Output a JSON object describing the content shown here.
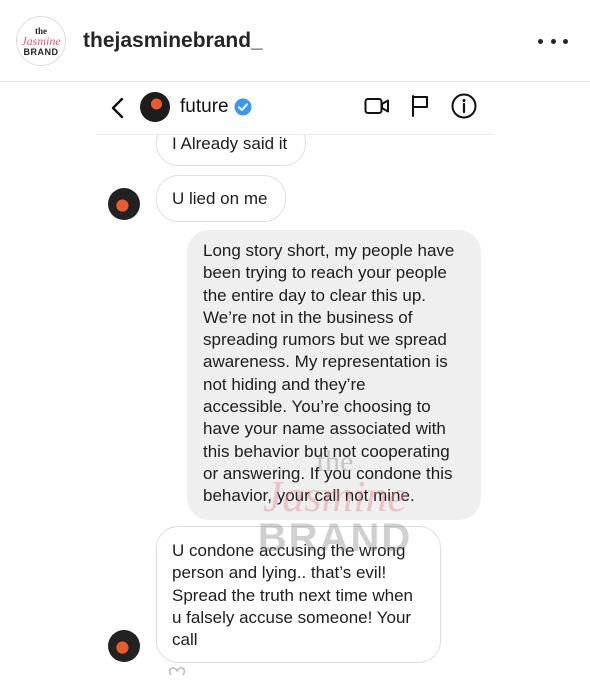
{
  "post": {
    "avatar_line1": "the",
    "avatar_line2": "Jasmine",
    "avatar_line3": "BRAND",
    "username": "thejasminebrand_",
    "more_icon": "more-horizontal-icon"
  },
  "dm": {
    "contact_name": "future",
    "verified": true,
    "icons": [
      "back-icon",
      "verified-badge-icon",
      "video-call-icon",
      "flag-icon",
      "info-icon"
    ]
  },
  "messages": [
    {
      "direction": "incoming",
      "text": "I Already said it"
    },
    {
      "direction": "incoming",
      "text": "U lied on me"
    },
    {
      "direction": "outgoing",
      "lines": [
        "Long story short, my people have",
        "been trying to reach your people",
        "the entire day to clear this up.",
        "We’re not in the business of",
        "spreading rumors but we spread",
        "awareness. My representation is",
        "not hiding and they’re",
        "accessible. You’re choosing to",
        "have your name associated with",
        "this behavior but not cooperating",
        "or answering. If you condone this",
        "behavior, your call not mine."
      ]
    },
    {
      "direction": "incoming",
      "lines": [
        "U condone accusing the wrong",
        "person and lying.. that’s evil!",
        "Spread the truth next time when",
        "u falsely accuse someone! Your",
        "call"
      ]
    }
  ],
  "watermark": {
    "line1": "the",
    "line2": "Jasmine",
    "line3": "BRAND"
  },
  "colors": {
    "verified": "#3897f0",
    "brand_pink": "#e8536b",
    "outgoing_bubble": "#efefef"
  }
}
